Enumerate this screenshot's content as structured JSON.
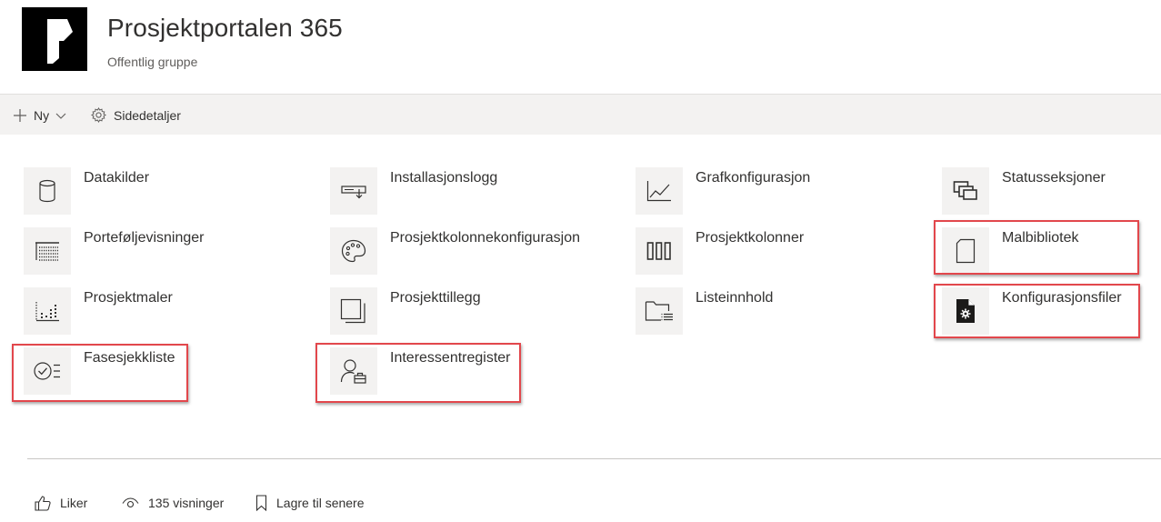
{
  "site": {
    "title": "Prosjektportalen 365",
    "subtitle": "Offentlig gruppe",
    "logo_icon": "project-portal-logo"
  },
  "command_bar": {
    "new_label": "Ny",
    "details_label": "Sidedetaljer"
  },
  "quick_links": [
    {
      "label": "Datakilder",
      "icon": "database-icon",
      "highlighted": false
    },
    {
      "label": "Installasjonslogg",
      "icon": "install-log-icon",
      "highlighted": false
    },
    {
      "label": "Grafkonfigurasjon",
      "icon": "line-chart-icon",
      "highlighted": false
    },
    {
      "label": "Statusseksjoner",
      "icon": "stacked-windows-icon",
      "highlighted": false
    },
    {
      "label": "Porteføljevisninger",
      "icon": "calendar-grid-icon",
      "highlighted": false
    },
    {
      "label": "Prosjektkolonnekonfigurasjon",
      "icon": "palette-icon",
      "highlighted": false
    },
    {
      "label": "Prosjektkolonner",
      "icon": "columns-icon",
      "highlighted": false
    },
    {
      "label": "Malbibliotek",
      "icon": "page-icon",
      "highlighted": true
    },
    {
      "label": "Prosjektmaler",
      "icon": "dotted-chart-icon",
      "highlighted": false
    },
    {
      "label": "Prosjekttillegg",
      "icon": "stacked-squares-icon",
      "highlighted": false
    },
    {
      "label": "Listeinnhold",
      "icon": "folder-list-icon",
      "highlighted": false
    },
    {
      "label": "Konfigurasjonsfiler",
      "icon": "config-file-icon",
      "highlighted": true
    },
    {
      "label": "Fasesjekkliste",
      "icon": "checklist-icon",
      "highlighted": true
    },
    {
      "label": "Interessentregister",
      "icon": "contact-briefcase-icon",
      "highlighted": true
    }
  ],
  "footer": {
    "like_label": "Liker",
    "views_label": "135 visninger",
    "save_label": "Lagre til senere"
  },
  "colors": {
    "highlight": "#e2474c",
    "command_bar_bg": "#f3f2f1",
    "icon_bg": "#f3f2f1",
    "text": "#323130"
  }
}
